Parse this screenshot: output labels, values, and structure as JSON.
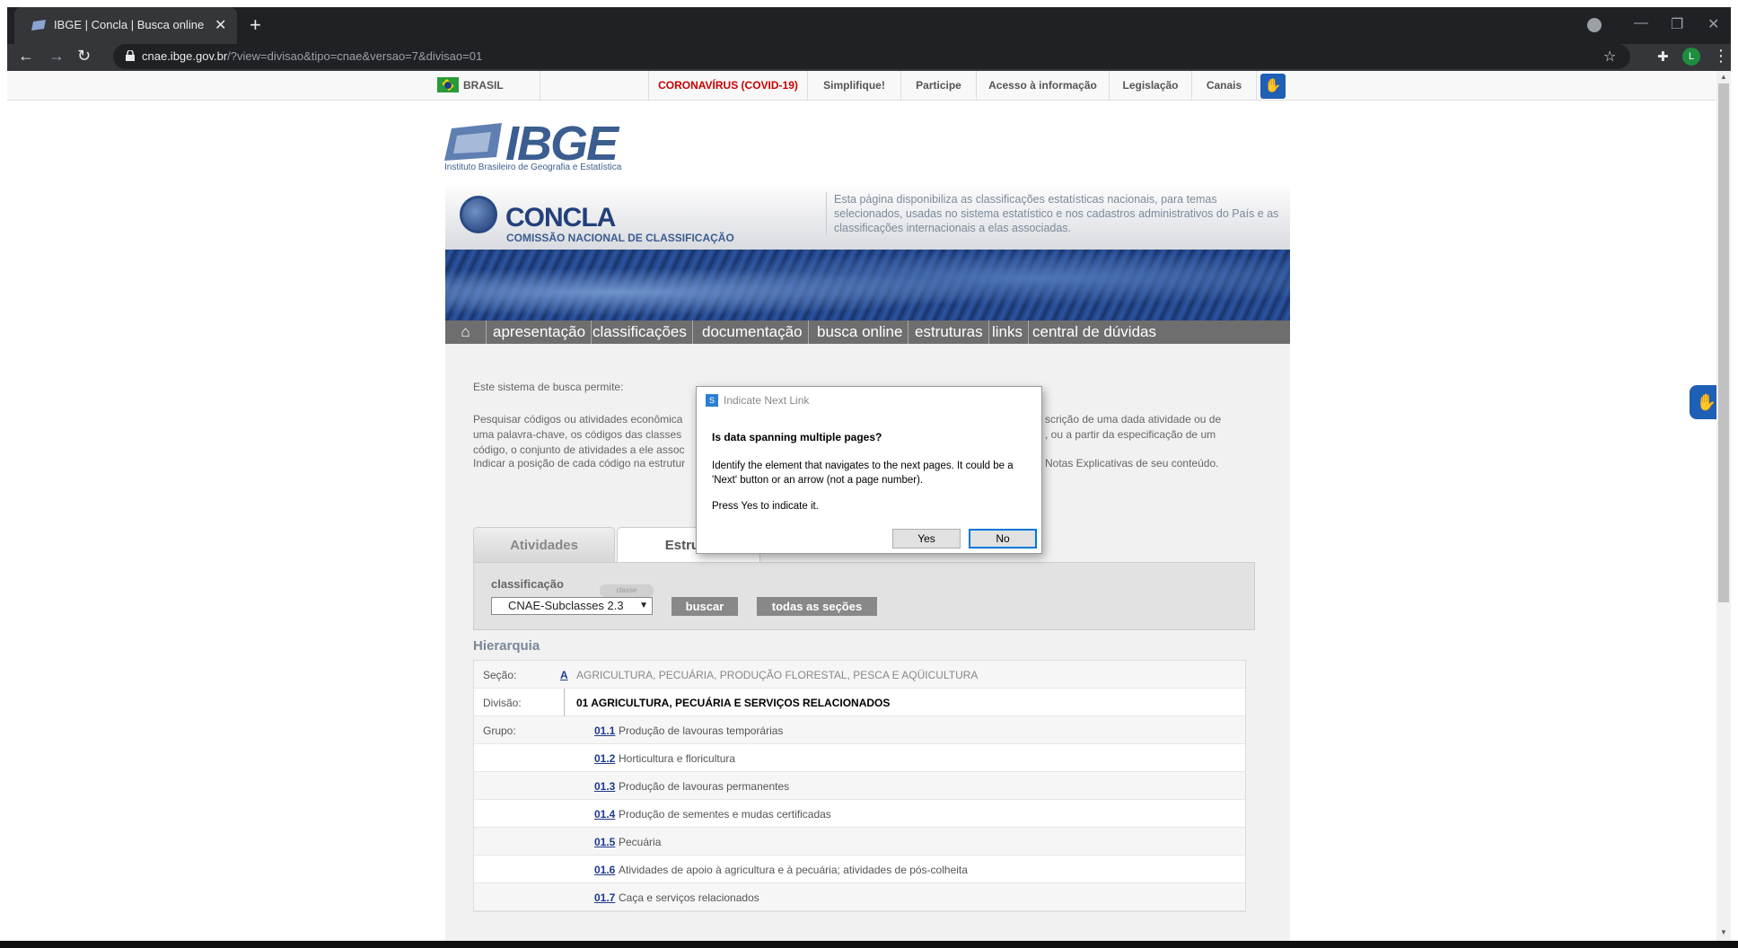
{
  "browser": {
    "tab_title": "IBGE | Concla | Busca online",
    "url_host": "cnae.ibge.gov.br",
    "url_path": "/?view=divisao&tipo=cnae&versao=7&divisao=01",
    "profile_initial": "L"
  },
  "gov_bar": {
    "brasil": "BRASIL",
    "covid": "CORONAVÍRUS (COVID-19)",
    "items": [
      "Simplifique!",
      "Participe",
      "Acesso à informação",
      "Legislação",
      "Canais"
    ]
  },
  "ibge": {
    "wordmark": "IBGE",
    "tagline": "Instituto Brasileiro de Geografia e Estatística"
  },
  "concla": {
    "name": "CONCLA",
    "subtitle": "COMISSÃO NACIONAL DE CLASSIFICAÇÃO",
    "description": "Esta página disponibiliza as classificações estatísticas nacionais, para temas selecionados, usadas no sistema estatístico e nos cadastros administrativos do País e as classificações internacionais a elas associadas."
  },
  "main_nav": [
    "apresentação",
    "classificações",
    "documentação",
    "busca online",
    "estruturas",
    "links",
    "central de dúvidas"
  ],
  "intro": {
    "line1": "Este sistema de busca permite:",
    "p2_left": "Pesquisar códigos ou atividades econômica",
    "p2_left2": "uma palavra-chave, os códigos das classes",
    "p2_left3": "código, o conjunto de atividades a ele assoc",
    "p2_right": "scrição de uma dada atividade ou de",
    "p2_right2": ", ou a partir da especificação de um",
    "p3_left": "Indicar a posição de cada código na estrutur",
    "p3_right": "Notas Explicativas de seu conteúdo."
  },
  "search": {
    "tabs": [
      "Atividades",
      "Estrutu"
    ],
    "label": "classificação",
    "tag": "classe",
    "selected": "CNAE-Subclasses 2.3",
    "buscar": "buscar",
    "todas": "todas as seções"
  },
  "hierarchy": {
    "title": "Hierarquia",
    "secao_label": "Seção:",
    "secao_code": "A",
    "secao_desc": "AGRICULTURA, PECUÁRIA, PRODUÇÃO FLORESTAL, PESCA E AQÜICULTURA",
    "divisao_label": "Divisão:",
    "divisao_desc": "01 AGRICULTURA, PECUÁRIA E SERVIÇOS RELACIONADOS",
    "grupo_label": "Grupo:",
    "groups": [
      {
        "code": "01.1",
        "desc": "Produção de lavouras temporárias"
      },
      {
        "code": "01.2",
        "desc": "Horticultura e floricultura"
      },
      {
        "code": "01.3",
        "desc": "Produção de lavouras permanentes"
      },
      {
        "code": "01.4",
        "desc": "Produção de sementes e mudas certificadas"
      },
      {
        "code": "01.5",
        "desc": "Pecuária"
      },
      {
        "code": "01.6",
        "desc": "Atividades de apoio à agricultura e à pecuária; atividades de pós-colheita"
      },
      {
        "code": "01.7",
        "desc": "Caça e serviços relacionados"
      }
    ]
  },
  "dialog": {
    "title": "Indicate Next Link",
    "heading": "Is data spanning multiple pages?",
    "body": "Identify the element that navigates to the next pages. It could be a 'Next' button or an arrow (not a page number).",
    "press": "Press Yes to indicate it.",
    "yes": "Yes",
    "no": "No"
  }
}
